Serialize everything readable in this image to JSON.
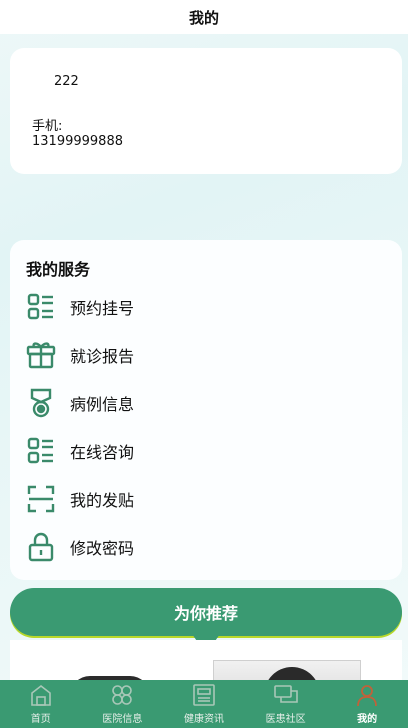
{
  "header": {
    "title": "我的"
  },
  "profile": {
    "name": "222",
    "phone_label": "手机:",
    "phone": "13199999888"
  },
  "services": {
    "title": "我的服务",
    "items": [
      {
        "label": "预约挂号",
        "icon": "list-icon"
      },
      {
        "label": "就诊报告",
        "icon": "gift-icon"
      },
      {
        "label": "病例信息",
        "icon": "medal-icon"
      },
      {
        "label": "在线咨询",
        "icon": "list-icon"
      },
      {
        "label": "我的发贴",
        "icon": "scan-icon"
      },
      {
        "label": "修改密码",
        "icon": "lock-icon"
      }
    ]
  },
  "recommend": {
    "label": "为你推荐"
  },
  "tabbar": {
    "items": [
      {
        "label": "首页",
        "icon": "home-icon"
      },
      {
        "label": "医院信息",
        "icon": "clover-icon"
      },
      {
        "label": "健康资讯",
        "icon": "newspaper-icon"
      },
      {
        "label": "医患社区",
        "icon": "chat-icon"
      },
      {
        "label": "我的",
        "icon": "user-icon",
        "active": true
      }
    ]
  },
  "colors": {
    "accent": "#3a9a72",
    "icon": "#3a8a6a",
    "accent_shadow": "#b8d82a",
    "tab_icon_inactive": "#a9c7b8",
    "tab_icon_active": "#c0623a"
  }
}
